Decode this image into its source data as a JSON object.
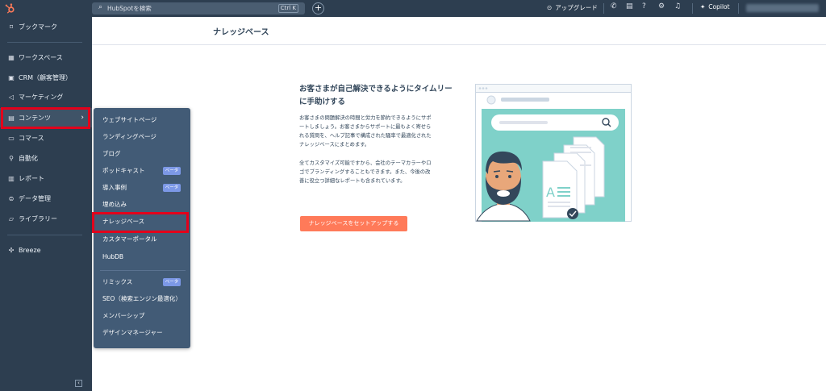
{
  "topbar": {
    "search_placeholder": "HubSpotを検索",
    "search_shortcut": "Ctrl K",
    "add_label": "+",
    "upgrade_label": "アップグレード",
    "copilot_label": "Copilot"
  },
  "sidebar": {
    "items": [
      {
        "label": "ブックマーク",
        "icon": "bookmark-icon"
      },
      {
        "label": "ワークスペース",
        "icon": "grid-icon"
      },
      {
        "label": "CRM（顧客管理）",
        "icon": "contacts-icon"
      },
      {
        "label": "マーケティング",
        "icon": "megaphone-icon"
      },
      {
        "label": "コンテンツ",
        "icon": "content-icon"
      },
      {
        "label": "コマース",
        "icon": "commerce-icon"
      },
      {
        "label": "自動化",
        "icon": "automation-icon"
      },
      {
        "label": "レポート",
        "icon": "reports-icon"
      },
      {
        "label": "データ管理",
        "icon": "database-icon"
      },
      {
        "label": "ライブラリー",
        "icon": "folder-icon"
      },
      {
        "label": "Breeze",
        "icon": "breeze-icon"
      }
    ]
  },
  "flyout": {
    "items": [
      {
        "label": "ウェブサイトページ",
        "badge": ""
      },
      {
        "label": "ランディングページ",
        "badge": ""
      },
      {
        "label": "ブログ",
        "badge": ""
      },
      {
        "label": "ポッドキャスト",
        "badge": "ベータ"
      },
      {
        "label": "導入事例",
        "badge": "ベータ"
      },
      {
        "label": "埋め込み",
        "badge": ""
      },
      {
        "label": "ナレッジベース",
        "badge": ""
      },
      {
        "label": "カスタマーポータル",
        "badge": ""
      },
      {
        "label": "HubDB",
        "badge": ""
      },
      {
        "label": "リミックス",
        "badge": "ベータ"
      },
      {
        "label": "SEO（検索エンジン最適化）",
        "badge": ""
      },
      {
        "label": "メンバーシップ",
        "badge": ""
      },
      {
        "label": "デザインマネージャー",
        "badge": ""
      }
    ]
  },
  "main": {
    "title": "ナレッジベース",
    "headline": "お客さまが自己解決できるようにタイムリーに手助けする",
    "paragraph1": "お客さまの問題解決の時間と労力を節約できるようにサポートしましょう。お客さまからサポートに最もよく寄せられる質問を、ヘルプ記事で構成された騒率で最適化されたナレッジベースにまとめます。",
    "paragraph2": "全てカスタマイズ可能ですから、会社のテーマカラーやロゴでブランディングすることもできます。また、今後の改善に役立つ詳細なレポートも含まれています。",
    "cta_label": "ナレッジベースをセットアップする"
  },
  "colors": {
    "nav_bg": "#2d3e50",
    "flyout_bg": "#425b76",
    "cta": "#ff7a59",
    "highlight": "#e3001b",
    "badge": "#7c98e6",
    "illustration_teal": "#7fd1c9"
  }
}
